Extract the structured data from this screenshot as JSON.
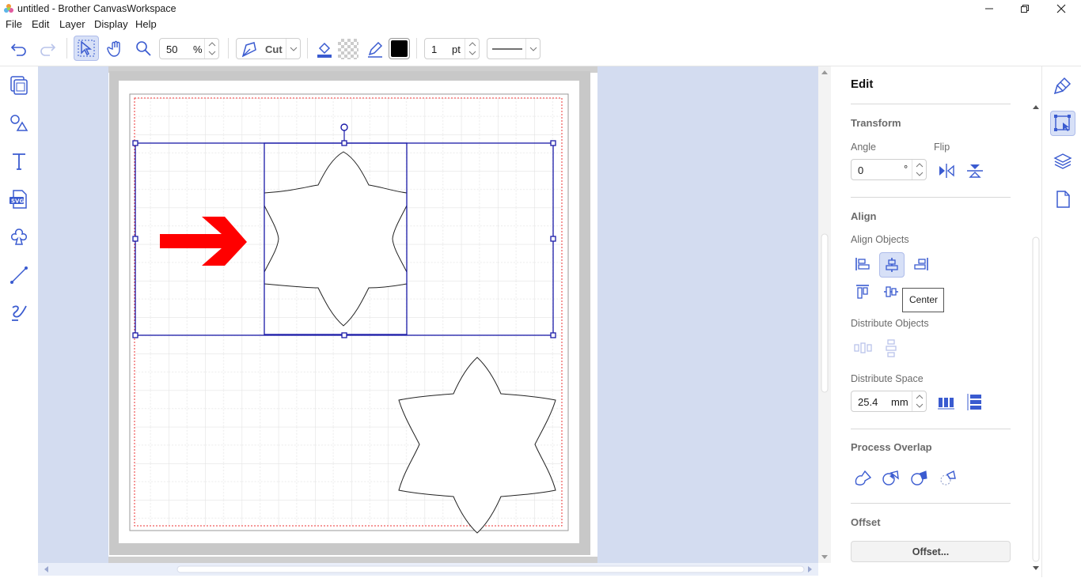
{
  "window": {
    "title": "untitled - Brother CanvasWorkspace"
  },
  "menu": [
    "File",
    "Edit",
    "Layer",
    "Display",
    "Help"
  ],
  "toolbar": {
    "zoom_value": "50",
    "zoom_unit": "%",
    "mode_label": "Cut",
    "line_width_value": "1",
    "line_width_unit": "pt"
  },
  "left_tools": [
    "pages-icon",
    "shapes-icon",
    "text-icon",
    "svg-icon",
    "pattern-icon",
    "line-icon",
    "freehand-icon"
  ],
  "panel": {
    "title": "Edit",
    "transform": {
      "heading": "Transform",
      "angle_label": "Angle",
      "angle_value": "0",
      "angle_unit": "°",
      "flip_label": "Flip"
    },
    "align": {
      "heading": "Align",
      "align_objects_label": "Align Objects",
      "tooltip": "Center",
      "distribute_objects_label": "Distribute Objects",
      "distribute_space_label": "Distribute Space",
      "space_value": "25.4",
      "space_unit": "mm"
    },
    "process": {
      "heading": "Process Overlap"
    },
    "offset": {
      "heading": "Offset",
      "button_label": "Offset..."
    }
  },
  "colors": {
    "accent": "#3a5bd0",
    "selection": "#1a1aa8",
    "canvas_bg": "#d3dcf0",
    "arrow": "#ff0000"
  }
}
